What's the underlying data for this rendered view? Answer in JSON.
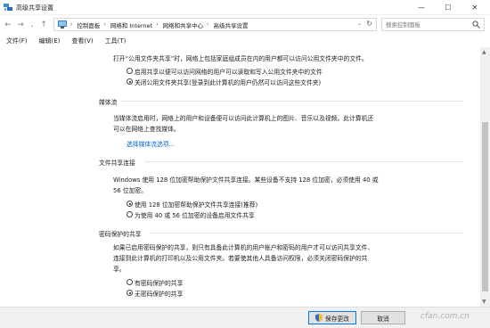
{
  "window": {
    "title": "高级共享设置",
    "minimize_glyph": "—",
    "maximize_glyph": "☐",
    "close_glyph": "✕"
  },
  "address": {
    "back_glyph": "←",
    "forward_glyph": "→",
    "up_glyph": "↑",
    "dropdown_glyph": "⌄",
    "crumbs": [
      "控制面板",
      "网络和 Internet",
      "网络和共享中心",
      "高级共享设置"
    ],
    "separator": "›",
    "refresh_glyph": "↻",
    "search_placeholder": "搜索控制面板"
  },
  "menu": {
    "items": [
      "文件(F)",
      "编辑(E)",
      "查看(V)",
      "工具(T)"
    ]
  },
  "public_folder": {
    "description": "打开“公用文件夹共享”时，网络上包括家庭组成员在内的用户都可以访问公用文件夹中的文件。",
    "options": [
      {
        "label": "启用共享以便可以访问网络的用户可以读取和写入公用文件夹中的文件",
        "selected": false
      },
      {
        "label": "关闭公用文件夹共享(登录到此计算机的用户仍然可以访问这些文件夹)",
        "selected": true
      }
    ]
  },
  "media_streaming": {
    "header": "媒体流",
    "description_line1": "当媒体流启用时，网络上的用户和设备便可以访问此计算机上的图片、音乐以及视频。此计算机还",
    "description_line2": "可以在网络上查找媒体。",
    "link": "选择媒体流选项..."
  },
  "file_sharing": {
    "header": "文件共享连接",
    "description_line1": "Windows 使用 128 位加密帮助保护文件共享连接。某些设备不支持 128 位加密，必须使用 40 或",
    "description_line2": "56 位加密。",
    "options": [
      {
        "label": "使用 128 位加密帮助保护文件共享连接(推荐)",
        "selected": true
      },
      {
        "label": "为使用 40 或 56 位加密的设备启用文件共享",
        "selected": false
      }
    ]
  },
  "password_sharing": {
    "header": "密码保护的共享",
    "description_line1": "如果已启用密码保护的共享，则只有具备此计算机的用户帐户和密码的用户才可以访问共享文件、",
    "description_line2": "连接到此计算机的打印机以及公用文件夹。若要使其他人具备访问权限，必须关闭密码保护的共",
    "description_line3": "享。",
    "options": [
      {
        "label": "有密码保护的共享",
        "selected": false
      },
      {
        "label": "无密码保护的共享",
        "selected": true
      }
    ]
  },
  "footer": {
    "save_label": "保存更改",
    "cancel_label": "取消"
  },
  "watermark": "cfan.com.cn",
  "colors": {
    "link": "#0066cc",
    "primary_border": "#0078d7",
    "footer_bg": "#f0f0f0"
  }
}
